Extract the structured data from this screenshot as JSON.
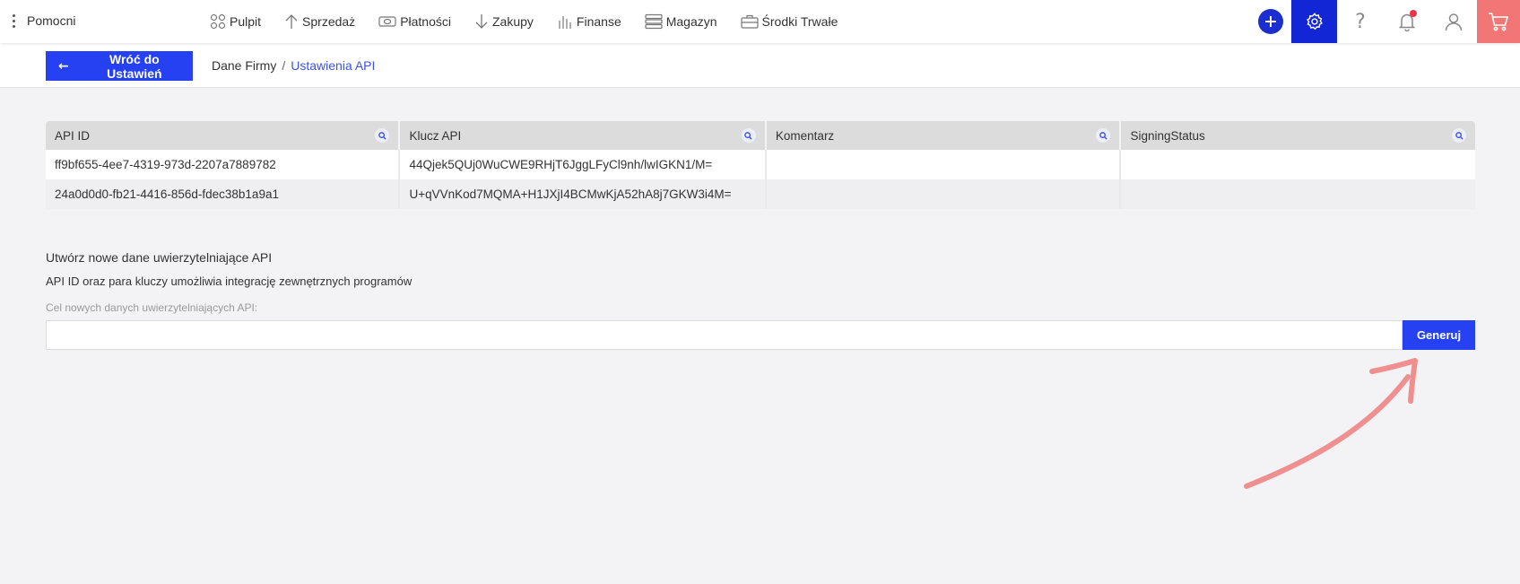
{
  "topbar": {
    "brand": "Pomocni",
    "nav": [
      {
        "label": "Pulpit",
        "icon": "dashboard-icon"
      },
      {
        "label": "Sprzedaż",
        "icon": "arrow-up-icon"
      },
      {
        "label": "Płatności",
        "icon": "payment-icon"
      },
      {
        "label": "Zakupy",
        "icon": "arrow-down-icon"
      },
      {
        "label": "Finanse",
        "icon": "bar-chart-icon"
      },
      {
        "label": "Magazyn",
        "icon": "warehouse-icon"
      },
      {
        "label": "Środki Trwałe",
        "icon": "briefcase-icon"
      }
    ],
    "tools": {
      "help_glyph": "?",
      "accent": "#1326d6",
      "cart_color": "#f27676"
    }
  },
  "subbar": {
    "back_label": "Wróć do Ustawień",
    "breadcrumb": {
      "prev": "Dane Firmy",
      "separator": "/",
      "current": "Ustawienia API"
    }
  },
  "table": {
    "columns": [
      "API ID",
      "Klucz API",
      "Komentarz",
      "SigningStatus"
    ],
    "rows": [
      [
        "ff9bf655-4ee7-4319-973d-2207a7889782",
        "44Qjek5QUj0WuCWE9RHjT6JggLFyCl9nh/lwIGKN1/M=",
        "",
        ""
      ],
      [
        "24a0d0d0-fb21-4416-856d-fdec38b1a9a1",
        "U+qVVnKod7MQMA+H1JXjI4BCMwKjA52hA8j7GKW3i4M=",
        "",
        ""
      ]
    ]
  },
  "create": {
    "title": "Utwórz nowe dane uwierzytelniające API",
    "description": "API ID oraz para kluczy umożliwia integrację zewnętrznych programów",
    "label": "Cel nowych danych uwierzytelniających API:",
    "input_value": "",
    "input_placeholder": "",
    "generate_label": "Generuj"
  },
  "colors": {
    "primary": "#2541f2",
    "link": "#3c52e8",
    "annotation": "#f08f8f"
  }
}
